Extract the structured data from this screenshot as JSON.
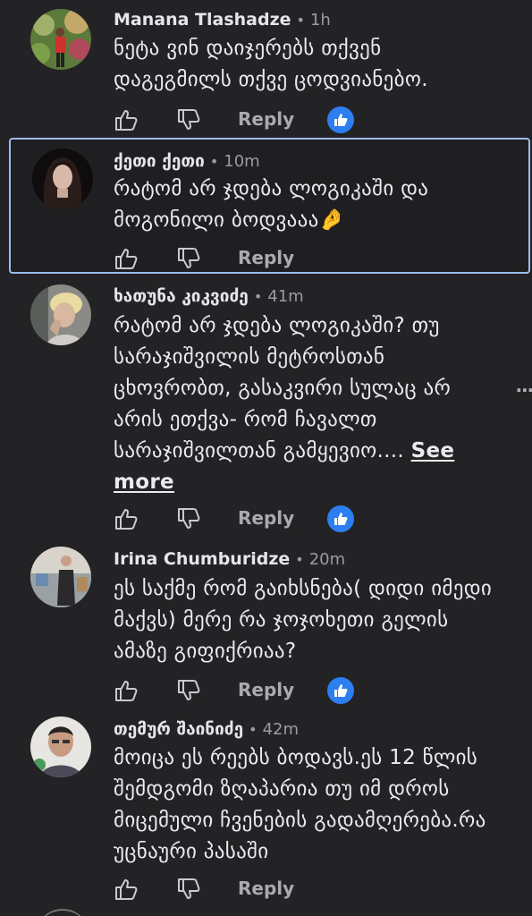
{
  "reply_label": "Reply",
  "comments": [
    {
      "author": "Manana Tlashadze",
      "time": "1h",
      "text": "ნეტა ვინ დაიჯერებს თქვენ დაგეგმილს თქვე ცოდვიანებო.",
      "liked": true
    },
    {
      "author": "ქეთი ქეთი",
      "time": "10m",
      "text": "რატომ არ ჯდება ლოგიკაში და მოგონილი ბოდვააა🤌",
      "liked": false,
      "highlighted": true
    },
    {
      "author": "ხათუნა კიკვიძე",
      "time": "41m",
      "text": "რატომ არ ჯდება ლოგიკაში? თუ სარაჯიშვილის მეტროსთან ცხოვრობთ, გასაკვირი სულაც არ არის ეთქვა- რომ ჩავალთ სარაჯიშვილთან გამყევიო....",
      "see_more": "See more",
      "liked": true
    },
    {
      "author": "Irina Chumburidze",
      "time": "20m",
      "text": "ეს საქმე რომ გაიხსნება( დიდი იმედი მაქვს) მერე რა ჯოჯოხეთი გელის ამაზე გიფიქრიაა?",
      "liked": true
    },
    {
      "author": "თემურ შაინიძე",
      "time": "42m",
      "text": "მოიცა ეს რეებს ბოდავს.ეს 12 წლის შემდგომი ზღაპარია თუ იმ დროს მიცემული ჩვენების გადამღერება.რა უცნაური პასაში",
      "liked": false
    }
  ],
  "colors": {
    "background": "#232325",
    "highlight_border": "#9bbcf0",
    "like_blue": "#2d7ef0"
  }
}
